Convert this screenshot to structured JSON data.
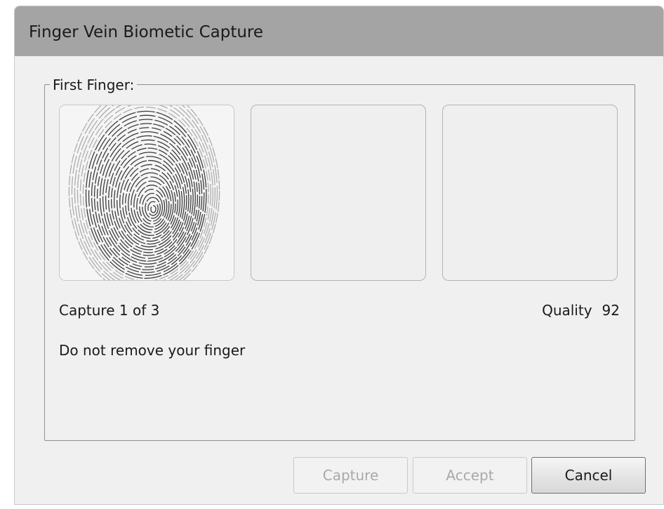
{
  "window": {
    "title": "Finger Vein Biometic Capture"
  },
  "group": {
    "label": "First Finger:",
    "slots": [
      {
        "state": "captured",
        "image": "fingerprint-image"
      },
      {
        "state": "empty"
      },
      {
        "state": "empty"
      }
    ]
  },
  "status": {
    "capture_progress": "Capture 1 of 3",
    "quality_label": "Quality",
    "quality_value": "92",
    "instruction": "Do not remove your finger"
  },
  "buttons": {
    "capture": {
      "label": "Capture",
      "enabled": false
    },
    "accept": {
      "label": "Accept",
      "enabled": false
    },
    "cancel": {
      "label": "Cancel",
      "enabled": true
    }
  }
}
